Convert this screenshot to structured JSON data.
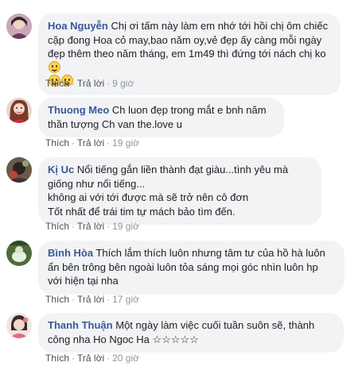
{
  "ui": {
    "like_label": "Thích",
    "reply_label": "Trả lời",
    "separator": "·"
  },
  "comments": [
    {
      "author": "Hoa Nguyễn",
      "text": "Chị ơi tấm này làm em nhớ tới hồi chị ôm chiếc cặp đong Hoa cỏ may,bao năm oy,vẻ đẹp ấy càng mỗi ngày đẹp thêm theo năm tháng, em 1m49 thì đứng tới nách chị ko",
      "emoji": [
        "smile-emoji",
        "smile-emoji",
        "smile-emoji"
      ],
      "time": "9 giờ"
    },
    {
      "author": "Thuong Meo",
      "text": "Ch luon đẹp trong mắt e bnh năm thần tượng Ch van the.love u",
      "time": "19 giờ"
    },
    {
      "author": "Kị Uc",
      "text": "Nổi tiếng gắn liền thành đạt giàu...tình yêu mà giống như nổi tiếng...\nkhông ai với tới được mà sẽ trở nên cô đơn\nTốt nhất để trái tim tự mách bảo tìm đến.",
      "time": "19 giờ"
    },
    {
      "author": "Bình Hòa",
      "text": "Thích lắm thích luôn nhưng tâm tư của hồ hà luôn ẩn bên trông bên ngoài luôn tỏa sáng mọi góc nhìn luôn hp với hiện tại nha",
      "time": "17 giờ"
    },
    {
      "author": "Thanh Thuận",
      "text": "Một ngày làm việc cuối tuần suôn sẽ, thành công nha Ho Ngoc Ha ☆☆☆☆☆",
      "time": "20 giờ"
    }
  ]
}
